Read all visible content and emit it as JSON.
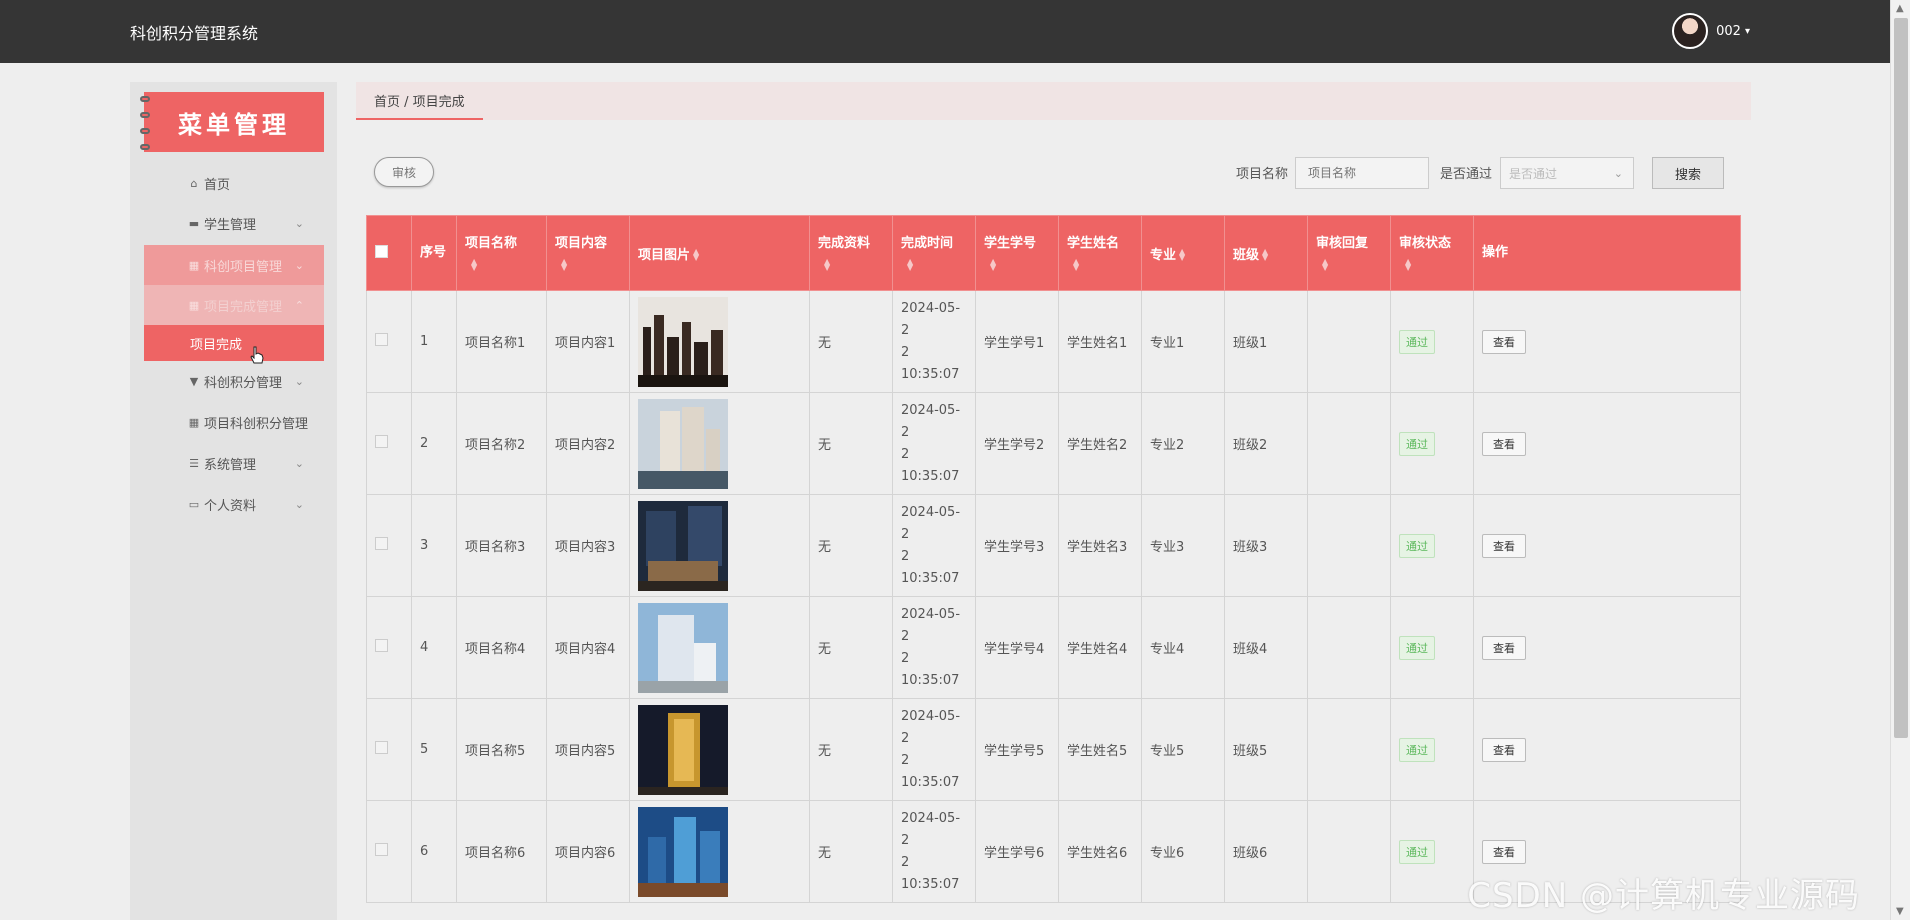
{
  "app": {
    "title": "科创积分管理系统"
  },
  "user": {
    "name": "002",
    "caret": "▾"
  },
  "sidebar": {
    "banner": "菜单管理",
    "items": [
      {
        "label": "首页",
        "icon": "⌂",
        "chevron": ""
      },
      {
        "label": "学生管理",
        "icon": "▬",
        "chevron": "⌄"
      },
      {
        "label": "科创项目管理",
        "icon": "▦",
        "chevron": "⌄"
      },
      {
        "label": "项目完成管理",
        "icon": "▦",
        "chevron": "⌃"
      },
      {
        "label": "科创积分管理",
        "icon": "▼",
        "chevron": "⌄"
      },
      {
        "label": "项目科创积分管理",
        "icon": "▦",
        "chevron": ""
      },
      {
        "label": "系统管理",
        "icon": "☰",
        "chevron": "⌄"
      },
      {
        "label": "个人资料",
        "icon": "▭",
        "chevron": "⌄"
      }
    ],
    "sub_item": "项目完成"
  },
  "breadcrumb": "首页 / 项目完成",
  "toolbar": {
    "audit_label": "审核",
    "name_label": "项目名称",
    "name_placeholder": "项目名称",
    "pass_label": "是否通过",
    "pass_placeholder": "是否通过",
    "search_label": "搜索"
  },
  "table": {
    "headers": [
      "序号",
      "项目名称",
      "项目内容",
      "项目图片",
      "完成资料",
      "完成时间",
      "学生学号",
      "学生姓名",
      "专业",
      "班级",
      "审核回复",
      "审核状态",
      "操作"
    ],
    "rows": [
      {
        "idx": "1",
        "name": "项目名称1",
        "content": "项目内容1",
        "material": "无",
        "time_a": "2024-05-2",
        "time_b": "2 10:35:07",
        "sid": "学生学号1",
        "sname": "学生姓名1",
        "major": "专业1",
        "cls": "班级1",
        "reply": "",
        "status": "通过",
        "action": "查看"
      },
      {
        "idx": "2",
        "name": "项目名称2",
        "content": "项目内容2",
        "material": "无",
        "time_a": "2024-05-2",
        "time_b": "2 10:35:07",
        "sid": "学生学号2",
        "sname": "学生姓名2",
        "major": "专业2",
        "cls": "班级2",
        "reply": "",
        "status": "通过",
        "action": "查看"
      },
      {
        "idx": "3",
        "name": "项目名称3",
        "content": "项目内容3",
        "material": "无",
        "time_a": "2024-05-2",
        "time_b": "2 10:35:07",
        "sid": "学生学号3",
        "sname": "学生姓名3",
        "major": "专业3",
        "cls": "班级3",
        "reply": "",
        "status": "通过",
        "action": "查看"
      },
      {
        "idx": "4",
        "name": "项目名称4",
        "content": "项目内容4",
        "material": "无",
        "time_a": "2024-05-2",
        "time_b": "2 10:35:07",
        "sid": "学生学号4",
        "sname": "学生姓名4",
        "major": "专业4",
        "cls": "班级4",
        "reply": "",
        "status": "通过",
        "action": "查看"
      },
      {
        "idx": "5",
        "name": "项目名称5",
        "content": "项目内容5",
        "material": "无",
        "time_a": "2024-05-2",
        "time_b": "2 10:35:07",
        "sid": "学生学号5",
        "sname": "学生姓名5",
        "major": "专业5",
        "cls": "班级5",
        "reply": "",
        "status": "通过",
        "action": "查看"
      },
      {
        "idx": "6",
        "name": "项目名称6",
        "content": "项目内容6",
        "material": "无",
        "time_a": "2024-05-2",
        "time_b": "2 10:35:07",
        "sid": "学生学号6",
        "sname": "学生姓名6",
        "major": "专业6",
        "cls": "班级6",
        "reply": "",
        "status": "通过",
        "action": "查看"
      }
    ]
  },
  "watermark": "CSDN @计算机专业源码",
  "colors": {
    "accent": "#ee6464",
    "topbar": "#353535",
    "status_green": "#5cb85c"
  }
}
